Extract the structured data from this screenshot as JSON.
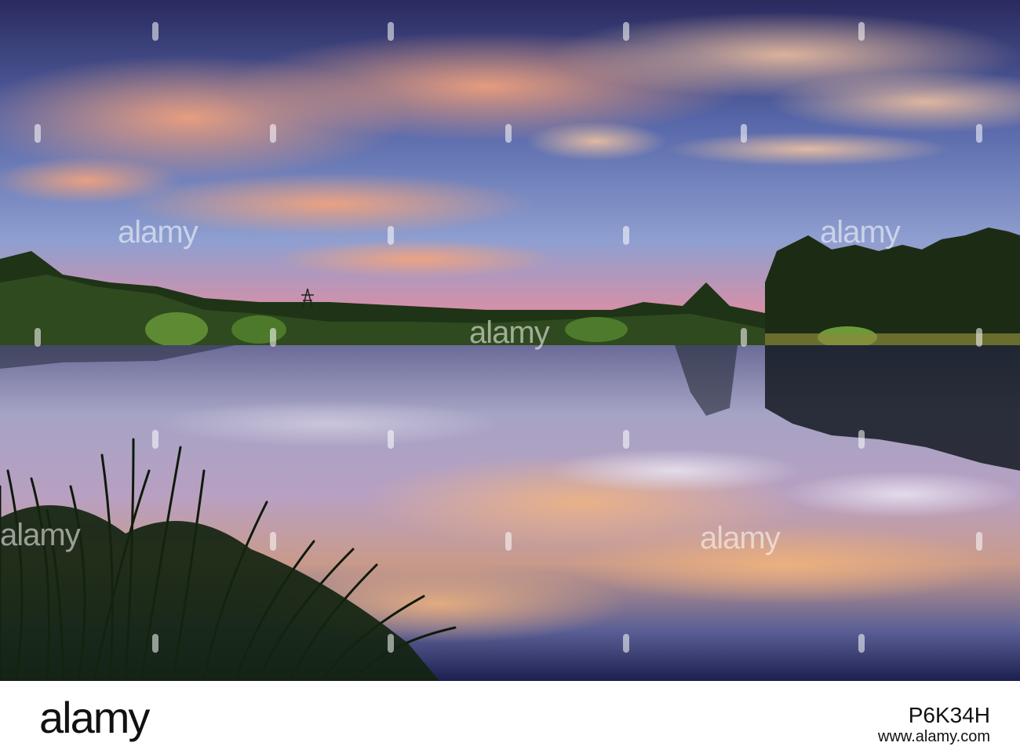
{
  "photo": {
    "alt": "",
    "watermark_text": "alamy",
    "colors": {
      "sky_top": "#2b2f63",
      "sky_mid": "#6a77b6",
      "sky_horizon": "#d9849a",
      "cloud_pink": "#f29a7e",
      "cloud_orange": "#f4b17f",
      "tree_dark": "#1c2a16",
      "tree_mid": "#3e5a26",
      "water_top": "#7a7fa8",
      "water_mid": "#c7a0b4",
      "water_bottom": "#1e2350"
    }
  },
  "footer": {
    "logo_text": "alamy",
    "image_id": "P6K34H",
    "url": "www.alamy.com"
  }
}
